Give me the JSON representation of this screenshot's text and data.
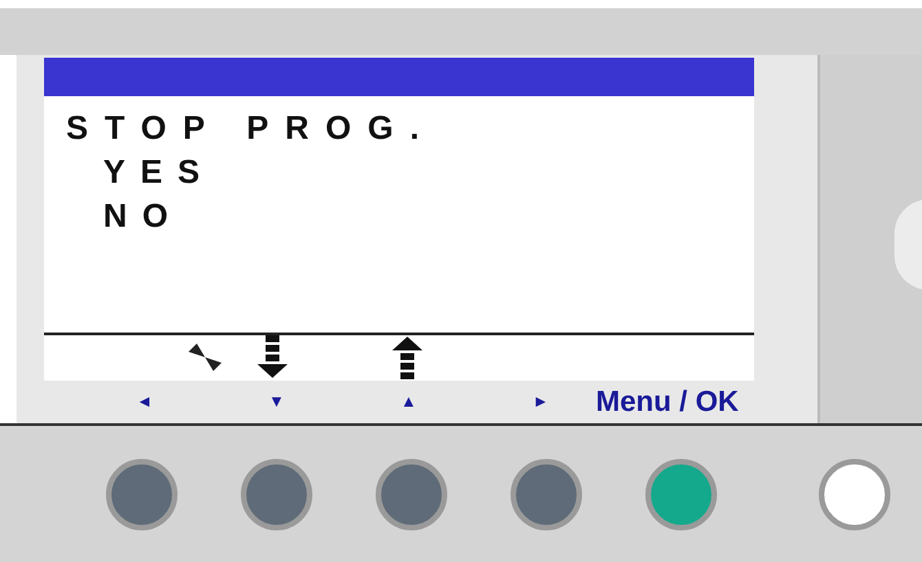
{
  "screen": {
    "title": "STOP PROG.",
    "options": [
      "YES",
      "NO"
    ]
  },
  "soft_keys": [
    "◄",
    "▼",
    "▲",
    "►"
  ],
  "menu_label": "Menu / OK",
  "buttons": [
    {
      "color": "#5f6b78"
    },
    {
      "color": "#5f6b78"
    },
    {
      "color": "#5f6b78"
    },
    {
      "color": "#5f6b78"
    },
    {
      "color": "#14a98c"
    },
    {
      "color": "#ffffff"
    }
  ]
}
